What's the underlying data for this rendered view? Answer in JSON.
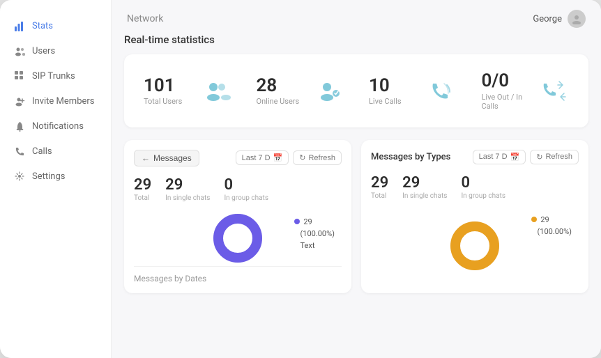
{
  "app": {
    "network_label": "Network",
    "user_name": "George"
  },
  "sidebar": {
    "items": [
      {
        "id": "stats",
        "label": "Stats",
        "active": true,
        "icon": "bar-chart"
      },
      {
        "id": "users",
        "label": "Users",
        "active": false,
        "icon": "users"
      },
      {
        "id": "sip-trunks",
        "label": "SIP Trunks",
        "active": false,
        "icon": "grid"
      },
      {
        "id": "invite-members",
        "label": "Invite Members",
        "active": false,
        "icon": "user-plus"
      },
      {
        "id": "notifications",
        "label": "Notifications",
        "active": false,
        "icon": "bell"
      },
      {
        "id": "calls",
        "label": "Calls",
        "active": false,
        "icon": "phone"
      },
      {
        "id": "settings",
        "label": "Settings",
        "active": false,
        "icon": "gear"
      }
    ]
  },
  "realtime_stats": {
    "title": "Real-time statistics",
    "cards": [
      {
        "id": "total-users",
        "number": "101",
        "label": "Total Users"
      },
      {
        "id": "online-users",
        "number": "28",
        "label": "Online Users"
      },
      {
        "id": "live-calls",
        "number": "10",
        "label": "Live Calls"
      },
      {
        "id": "live-out-in",
        "number": "0/0",
        "label": "Live Out / In Calls"
      }
    ]
  },
  "messages_panel": {
    "title": "← Messages",
    "date_filter": "Last 7 D",
    "refresh_label": "Refresh",
    "stats": [
      {
        "id": "total",
        "number": "29",
        "label": "Total"
      },
      {
        "id": "single-chats",
        "number": "29",
        "label": "In single chats"
      },
      {
        "id": "group-chats",
        "number": "0",
        "label": "In group chats"
      }
    ],
    "chart": {
      "color": "#6b5ce7",
      "legend_value": "29",
      "legend_pct": "(100.00%)",
      "legend_label": "Text"
    },
    "footer": "Messages by Dates"
  },
  "messages_by_types_panel": {
    "title": "Messages by Types",
    "date_filter": "Last 7 D",
    "refresh_label": "Refresh",
    "stats": [
      {
        "id": "total",
        "number": "29",
        "label": "Total"
      },
      {
        "id": "single-chats",
        "number": "29",
        "label": "In single chats"
      },
      {
        "id": "group-chats",
        "number": "0",
        "label": "In group chats"
      }
    ],
    "chart": {
      "color": "#e8a020",
      "legend_value": "29",
      "legend_pct": "(100.00%)",
      "legend_label": ""
    }
  },
  "colors": {
    "accent_blue": "#4a7de8",
    "icon_users": "#6bbfd4",
    "icon_online": "#6bbfd4",
    "icon_calls": "#6bbfd4",
    "icon_out_in": "#6bbfd4",
    "donut_blue": "#6b5ce7",
    "donut_orange": "#e8a020"
  }
}
